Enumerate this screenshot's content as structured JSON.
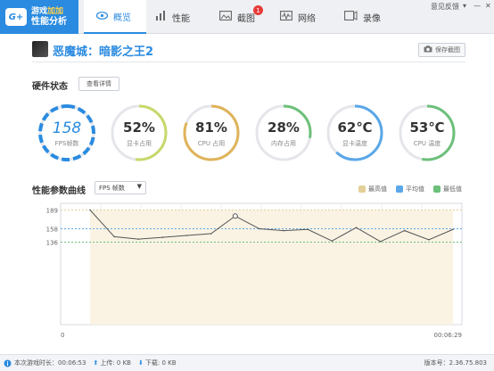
{
  "app": {
    "logo_badge": "G+",
    "logo_line1_a": "游戏",
    "logo_line1_b": "加加",
    "logo_line2": "性能分析"
  },
  "tabs": [
    {
      "label": "概览",
      "icon": "eye-icon"
    },
    {
      "label": "性能",
      "icon": "bar-chart-icon"
    },
    {
      "label": "截图",
      "icon": "image-icon",
      "badge": "1"
    },
    {
      "label": "网络",
      "icon": "network-icon"
    },
    {
      "label": "录像",
      "icon": "video-icon"
    }
  ],
  "window": {
    "feedback": "意见反馈",
    "dropdown": "▾",
    "minimize": "—",
    "close": "✕"
  },
  "game": {
    "title": "恶魔城：暗影之王2",
    "save_label": "保存截图"
  },
  "hardware": {
    "title": "硬件状态",
    "detail_label": "查看详情",
    "gauges": [
      {
        "value": "158",
        "caption": "FPS帧数",
        "color": "#2a8be0",
        "fraction": 1.0
      },
      {
        "value": "52%",
        "caption": "显卡占用",
        "color": "#c8d86a",
        "fraction": 0.52
      },
      {
        "value": "81%",
        "caption": "CPU 占用",
        "color": "#e0b35a",
        "fraction": 0.81
      },
      {
        "value": "28%",
        "caption": "内存占用",
        "color": "#6cc07a",
        "fraction": 0.28
      },
      {
        "value": "62℃",
        "caption": "显卡温度",
        "color": "#5aa7e8",
        "fraction": 0.62
      },
      {
        "value": "53℃",
        "caption": "CPU 温度",
        "color": "#6cc07a",
        "fraction": 0.53
      }
    ]
  },
  "perf": {
    "title": "性能参数曲线",
    "select_value": "FPS 帧数",
    "legend": [
      {
        "label": "最高值",
        "color": "#e3cf98"
      },
      {
        "label": "平均值",
        "color": "#5aa7e8"
      },
      {
        "label": "最低值",
        "color": "#6cc07a"
      }
    ]
  },
  "chart_data": {
    "type": "line",
    "y_ticks": [
      "189",
      "158",
      "136"
    ],
    "max": 189,
    "avg": 158,
    "min": 136,
    "ylim": [
      0,
      200
    ],
    "x_start_label": "0",
    "x_end_label": "00:06:29",
    "series": [
      {
        "values": [
          189,
          145,
          141,
          144,
          147,
          150,
          179,
          158,
          155,
          157,
          138,
          160,
          137,
          155,
          140,
          157
        ]
      }
    ]
  },
  "footer": {
    "duration_label": "本次游戏时长：",
    "duration_value": "00:06:53",
    "upload_label": "上传: 0 KB",
    "download_label": "下载: 0 KB",
    "version_label": "版本号：2.36.75.803"
  }
}
